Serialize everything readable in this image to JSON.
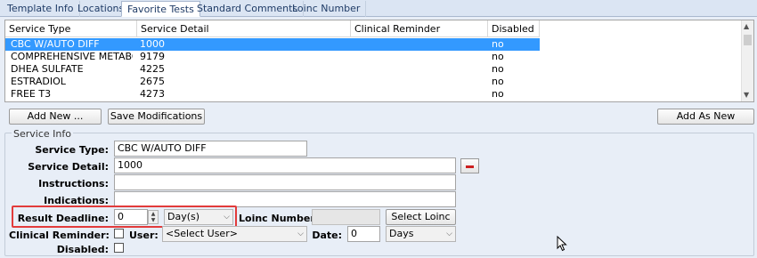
{
  "tabs": [
    {
      "label": "Template Info",
      "active": false
    },
    {
      "label": "Locations",
      "active": false
    },
    {
      "label": "Favorite Tests",
      "active": true
    },
    {
      "label": "Standard Comments",
      "active": false
    },
    {
      "label": "Loinc Number",
      "active": false
    }
  ],
  "grid": {
    "columns": [
      "Service Type",
      "Service Detail",
      "Clinical Reminder",
      "Disabled"
    ],
    "rows": [
      {
        "service_type": "CBC W/AUTO DIFF",
        "service_detail": "1000",
        "clinical_reminder": "",
        "disabled": "no",
        "selected": true
      },
      {
        "service_type": "COMPREHENSIVE METABOL...",
        "service_detail": "9179",
        "clinical_reminder": "",
        "disabled": "no",
        "selected": false
      },
      {
        "service_type": "DHEA SULFATE",
        "service_detail": "4225",
        "clinical_reminder": "",
        "disabled": "no",
        "selected": false
      },
      {
        "service_type": "ESTRADIOL",
        "service_detail": "2675",
        "clinical_reminder": "",
        "disabled": "no",
        "selected": false
      },
      {
        "service_type": "FREE T3",
        "service_detail": "4273",
        "clinical_reminder": "",
        "disabled": "no",
        "selected": false
      }
    ]
  },
  "buttons": {
    "add_new": "Add New ...",
    "save_modifications": "Save Modifications",
    "add_as_new": "Add As New",
    "select_loinc": "Select Loinc"
  },
  "service_info": {
    "title": "Service Info",
    "service_type_label": "Service Type:",
    "service_type_value": "CBC W/AUTO DIFF",
    "service_detail_label": "Service Detail:",
    "service_detail_value": "1000",
    "instructions_label": "Instructions:",
    "instructions_value": "",
    "indications_label": "Indications:",
    "indications_value": "",
    "result_deadline_label": "Result Deadline:",
    "result_deadline_value": "0",
    "result_deadline_unit": "Day(s)",
    "loinc_number_label": "Loinc Number:",
    "loinc_number_value": "",
    "clinical_reminder_label": "Clinical Reminder:",
    "user_label": "User:",
    "user_value": "<Select User>",
    "date_label": "Date:",
    "date_value": "0",
    "date_unit": "Days",
    "disabled_label": "Disabled:"
  },
  "colors": {
    "accent": "#3399ff",
    "highlight_box": "#e23b3b",
    "remove_button": "#cc1f1f"
  }
}
